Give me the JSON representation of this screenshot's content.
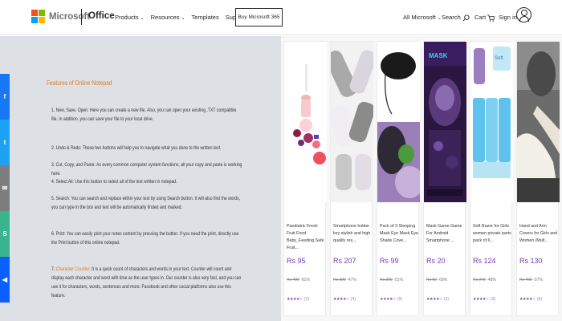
{
  "header": {
    "brand": "Microsoft",
    "product": "Office",
    "nav": [
      {
        "label": "Products",
        "has_dropdown": true
      },
      {
        "label": "Resources",
        "has_dropdown": true
      },
      {
        "label": "Templates",
        "has_dropdown": false
      },
      {
        "label": "Support",
        "has_dropdown": false
      }
    ],
    "buy_button": "Buy Microsoft 365",
    "all_microsoft": "All Microsoft",
    "search": "Search",
    "cart": "Cart",
    "sign_in": "Sign in",
    "brand_colors": [
      "#f25022",
      "#7fba00",
      "#00a4ef",
      "#ffb900"
    ]
  },
  "article": {
    "title": "Features of Online Notepad",
    "paragraphs": [
      {
        "text": "1. New, Save, Open: Here you can create a new file. Also, you can open your existing .TXT compatible file. In addition, you can save your file to your local drive.",
        "highlight": ""
      },
      {
        "text": "2. Undo & Redo: These two buttons will help you to navigate what you done to the written text.",
        "highlight": ""
      },
      {
        "text": "3. Cut, Copy, and Paste: As every common computer system functions, all your copy and paste is working here.",
        "highlight": ""
      },
      {
        "text": "4. Select All: Use this button to select all of the text written in notepad.",
        "highlight": ""
      },
      {
        "text": "5. Search: You can search and replace within your text by using Search button. It will also find the words, you can type in the box and text will be automatically finded and marked.",
        "highlight": ""
      },
      {
        "text": "6. Print: You can easily print your notes content by pressing the button. If you need the print, directly use the Print button of this online notepad.",
        "highlight": ""
      },
      {
        "text": "Character Counter: ",
        "highlight": "7. ",
        "rest": "It is a quick count of characters and words in your text. Counter will count and display each character and word with time as the user types in. Our counter is also very fast, and you can use it for characters, words, sentences and more. Facebook and other social platforms also use this feature."
      }
    ]
  },
  "social": [
    {
      "icon": "facebook-icon",
      "glyph": "f",
      "color": "#1877f2"
    },
    {
      "icon": "twitter-icon",
      "glyph": "t",
      "color": "#1da1f2"
    },
    {
      "icon": "email-icon",
      "glyph": "✉",
      "color": "#7d7d7d"
    },
    {
      "icon": "sharethis-icon",
      "glyph": "S",
      "color": "#38b48f"
    },
    {
      "icon": "share-icon",
      "glyph": "◀",
      "color": "#0b5fff"
    }
  ],
  "products": [
    {
      "title": "Paediatric Fresh Fruit Food Baby_Feeding Safe Fruit...",
      "price": "Rs 95",
      "old_price": "Rs 499",
      "discount": "-81%",
      "stars": 4,
      "reviews": "(2)",
      "img": "feeder"
    },
    {
      "title": "Smartphone holder key stylish and high quality res...",
      "price": "Rs 207",
      "old_price": "Rs 390",
      "discount": "-47%",
      "stars": 4,
      "reviews": "(4)",
      "img": "holder"
    },
    {
      "title": "Pack of 3 Sleeping Mask Eye Mask Eye Shade Cove...",
      "price": "Rs 99",
      "old_price": "Rs 200",
      "discount": "-51%",
      "stars": 4,
      "reviews": "(9)",
      "img": "mask"
    },
    {
      "title": "Mask Game Game For Android Smartphone ...",
      "price": "Rs 20",
      "old_price": "Rs 50",
      "discount": "-60%",
      "stars": 4,
      "reviews": "(1)",
      "img": "game"
    },
    {
      "title": "Soft Razor for Girls women private parts pack of 6...",
      "price": "Rs 124",
      "old_price": "Rs 240",
      "discount": "-48%",
      "stars": 4,
      "reviews": "(3)",
      "img": "razor"
    },
    {
      "title": "Hand and Arm Covers for Girls and Women (Mult...",
      "price": "Rs 130",
      "old_price": "Rs 499",
      "discount": "-57%",
      "stars": 4,
      "reviews": "(6)",
      "img": "gloves"
    }
  ]
}
